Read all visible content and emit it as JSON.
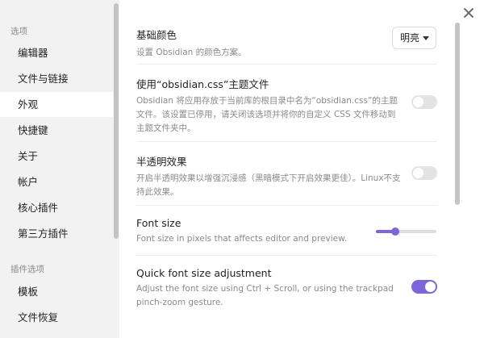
{
  "sidebar": {
    "group_options": "选项",
    "items": [
      {
        "label": "编辑器"
      },
      {
        "label": "文件与链接"
      },
      {
        "label": "外观"
      },
      {
        "label": "快捷键"
      },
      {
        "label": "关于"
      },
      {
        "label": "帐户"
      },
      {
        "label": "核心插件"
      },
      {
        "label": "第三方插件"
      }
    ],
    "active_item": "外观",
    "group_plugin_options": "插件选项",
    "plugin_items": [
      {
        "label": "模板"
      },
      {
        "label": "文件恢复"
      }
    ]
  },
  "settings": {
    "base_color": {
      "name": "基础颜色",
      "desc": "设置 Obsidian 的颜色方案。",
      "value": "明亮"
    },
    "theme_file": {
      "name": "使用“obsidian.css”主题文件",
      "desc": "Obsidian 将应用存放于当前库的根目录中名为“obsidian.css”的主题文件。该设置已停用，请关闭该选项并将你的自定义 CSS 文件移动到主题文件夹中。",
      "enabled": false
    },
    "translucency": {
      "name": "半透明效果",
      "desc": "开启半透明效果以增强沉浸感（黑暗模式下开启效果更佳）。Linux不支持此效果。",
      "enabled": false
    },
    "font_size": {
      "name": "Font size",
      "desc": "Font size in pixels that affects editor and preview.",
      "level_fraction": 0.32
    },
    "quick_font_size": {
      "name": "Quick font size adjustment",
      "desc": "Adjust the font size using Ctrl + Scroll, or using the trackpad pinch-zoom gesture.",
      "enabled": true
    }
  },
  "colors": {
    "accent": "#7d66d9",
    "sidebar_bg": "#f2f2f2",
    "main_bg": "#ffffff"
  },
  "icons": {
    "close": "close-icon",
    "dropdown": "chevron-down-icon"
  }
}
